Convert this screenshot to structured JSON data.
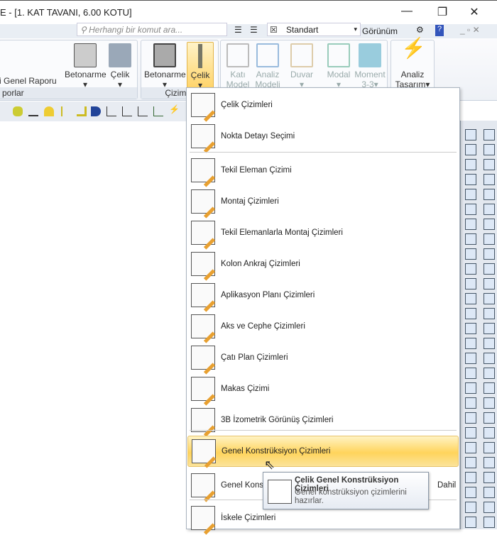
{
  "window": {
    "title": "E - [1. KAT TAVANI,  6.00 KOTU]",
    "minimize": "—",
    "restore": "❐",
    "close": "✕"
  },
  "quickbar": {
    "search_placeholder": "Herhangi bir komut ara...",
    "style_value": "Standart",
    "view_label": "Görünüm"
  },
  "ribbon": {
    "reports_group": "porlar",
    "report_button": "i Genel Raporu",
    "report_betonarme": "Betonarme",
    "report_celik": "Çelik",
    "drawing_group": "Çizim Ol",
    "draw_betonarme": "Betonarme",
    "draw_celik": "Çelik",
    "kati_model": [
      "Katı",
      "Model"
    ],
    "analiz_modeli": [
      "Analiz",
      "Modeli"
    ],
    "duvar": "Duvar",
    "modal": "Modal",
    "moment": [
      "Moment",
      "3-3"
    ],
    "analiz_tasarim": [
      "Analiz",
      "Tasarım"
    ]
  },
  "menu": {
    "items": [
      {
        "label": "Çelik Çizimleri"
      },
      {
        "label": "Nokta Detayı Seçimi"
      },
      {
        "label": "Tekil Eleman Çizimi"
      },
      {
        "label": "Montaj Çizimleri"
      },
      {
        "label": "Tekil Elemanlarla Montaj Çizimleri"
      },
      {
        "label": "Kolon Ankraj Çizimleri"
      },
      {
        "label": "Aplikasyon Planı Çizimleri"
      },
      {
        "label": "Aks ve Cephe Çizimleri"
      },
      {
        "label": "Çatı Plan Çizimleri"
      },
      {
        "label": "Makas Çizimi"
      },
      {
        "label": "3B İzometrik Görünüş Çizimleri"
      },
      {
        "label": "Genel Konstrüksiyon Çizimleri"
      },
      {
        "label": "Genel Konstr",
        "suffix": "Dahil"
      },
      {
        "label": "İskele Çizimleri"
      }
    ]
  },
  "tooltip": {
    "title": "Çelik Genel Konstrüksiyon Çizimleri",
    "description": "Genel konstrüksiyon çizimlerini hazırlar."
  },
  "colors": {
    "highlight": "#ffd45c",
    "accent": "#e8a030"
  }
}
